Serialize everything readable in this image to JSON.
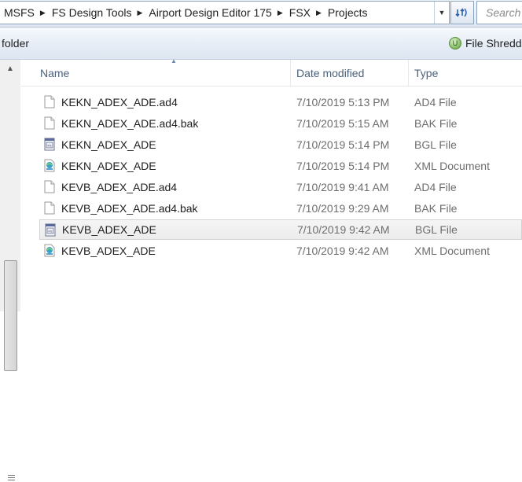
{
  "address": {
    "crumbs": [
      "MSFS",
      "FS Design Tools",
      "Airport Design Editor 175",
      "FSX",
      "Projects"
    ],
    "search_placeholder": "Search"
  },
  "toolbar": {
    "left_label": "folder",
    "right_label": "File Shredd"
  },
  "columns": {
    "name": "Name",
    "date": "Date modified",
    "type": "Type"
  },
  "files": [
    {
      "name": "KEKN_ADEX_ADE.ad4",
      "date": "7/10/2019 5:13 PM",
      "type": "AD4 File",
      "icon": "blank-file-icon"
    },
    {
      "name": "KEKN_ADEX_ADE.ad4.bak",
      "date": "7/10/2019 5:15 AM",
      "type": "BAK File",
      "icon": "blank-file-icon"
    },
    {
      "name": "KEKN_ADEX_ADE",
      "date": "7/10/2019 5:14 PM",
      "type": "BGL File",
      "icon": "bgl-file-icon"
    },
    {
      "name": "KEKN_ADEX_ADE",
      "date": "7/10/2019 5:14 PM",
      "type": "XML Document",
      "icon": "xml-file-icon"
    },
    {
      "name": "KEVB_ADEX_ADE.ad4",
      "date": "7/10/2019 9:41 AM",
      "type": "AD4 File",
      "icon": "blank-file-icon"
    },
    {
      "name": "KEVB_ADEX_ADE.ad4.bak",
      "date": "7/10/2019 9:29 AM",
      "type": "BAK File",
      "icon": "blank-file-icon"
    },
    {
      "name": "KEVB_ADEX_ADE",
      "date": "7/10/2019 9:42 AM",
      "type": "BGL File",
      "icon": "bgl-file-icon",
      "hover": true
    },
    {
      "name": "KEVB_ADEX_ADE",
      "date": "7/10/2019 9:42 AM",
      "type": "XML Document",
      "icon": "xml-file-icon"
    }
  ]
}
